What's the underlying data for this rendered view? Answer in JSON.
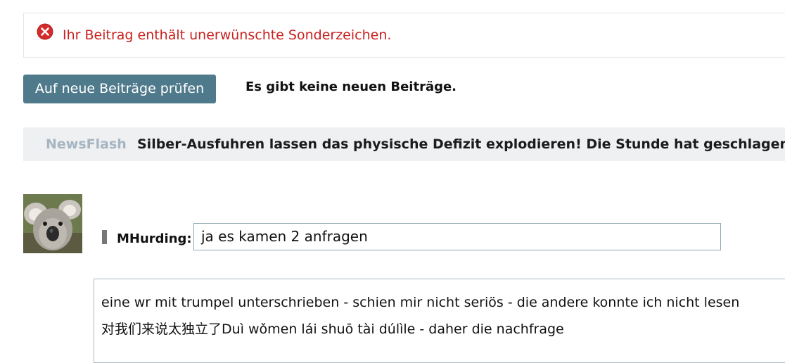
{
  "error": {
    "icon": "error-circle-x-icon",
    "color": "#c8201e",
    "message": "Ihr Beitrag enthält unerwünschte Sonderzeichen."
  },
  "toolbar": {
    "check_button_label": "Auf neue Beiträge prüfen",
    "status_text": "Es gibt keine neuen Beiträge."
  },
  "newsflash": {
    "label": "NewsFlash",
    "headline": "Silber-Ausfuhren lassen das physische Defizit explodieren! Die Stunde hat geschlagen!"
  },
  "reply": {
    "avatar": "koala-avatar",
    "username": "MHurding:",
    "input_value": "ja es kamen 2 anfragen"
  },
  "post": {
    "line1": "eine wr mit trumpel unterschrieben - schien mir nicht seriös - die andere konnte ich nicht lesen",
    "line2": "对我们来说太独立了Duì wǒmen lái shuō tài dúlìle - daher die nachfrage"
  },
  "colors": {
    "button_bg": "#4f7a8c",
    "newsflash_bg": "#eef0f2",
    "newsflash_label": "#a6b5c1"
  }
}
